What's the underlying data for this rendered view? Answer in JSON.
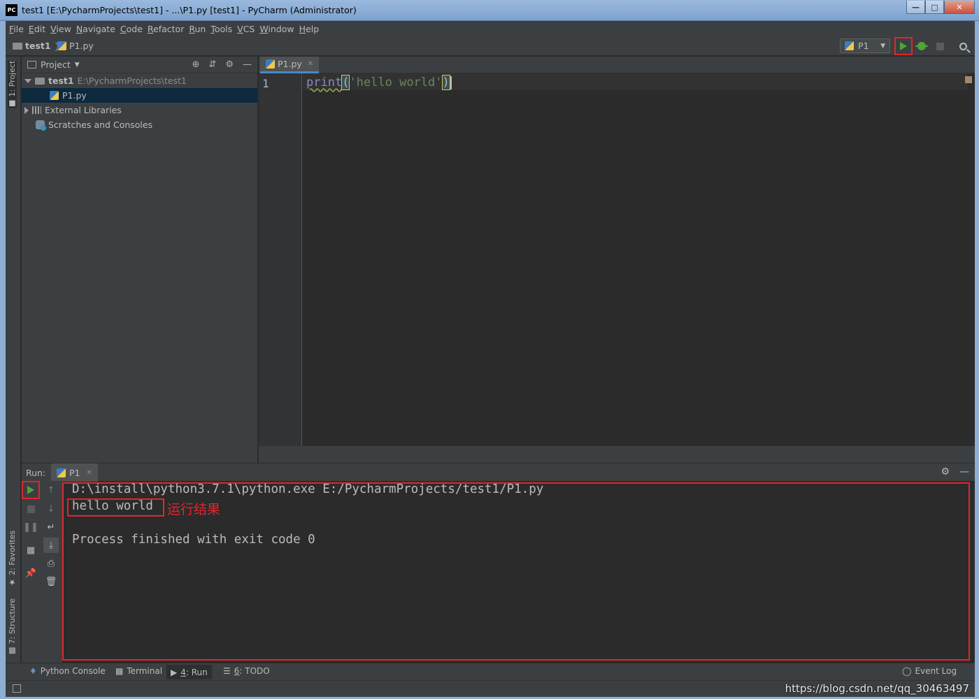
{
  "window": {
    "app_icon": "PC",
    "title": "test1 [E:\\PycharmProjects\\test1] - ...\\P1.py [test1] - PyCharm (Administrator)",
    "buttons": [
      "minimize",
      "maximize",
      "close"
    ]
  },
  "menu": [
    {
      "mnemonic": "F",
      "rest": "ile"
    },
    {
      "mnemonic": "E",
      "rest": "dit"
    },
    {
      "mnemonic": "V",
      "rest": "iew"
    },
    {
      "mnemonic": "N",
      "rest": "avigate"
    },
    {
      "mnemonic": "C",
      "rest": "ode"
    },
    {
      "mnemonic": "R",
      "rest": "efactor"
    },
    {
      "mnemonic": "R",
      "rest": "un"
    },
    {
      "mnemonic": "T",
      "rest": "ools"
    },
    {
      "mnemonic": "V",
      "rest": "CS"
    },
    {
      "mnemonic": "W",
      "rest": "indow"
    },
    {
      "mnemonic": "H",
      "rest": "elp"
    }
  ],
  "breadcrumb": {
    "project": "test1",
    "file": "P1.py"
  },
  "run_config": {
    "name": "P1",
    "run_icon": "run-icon",
    "debug_icon": "debug-icon",
    "stop_icon": "stop-icon",
    "search_icon": "search-icon",
    "highlight_color": "#e0262d",
    "run_color": "#4fa43b"
  },
  "side_tabs": {
    "project": "1: Project",
    "favorites": "2: Favorites",
    "structure": "7: Structure"
  },
  "project_panel": {
    "title": "Project",
    "root": {
      "name": "test1",
      "path": "E:\\PycharmProjects\\test1"
    },
    "file": "P1.py",
    "external": "External Libraries",
    "scratches": "Scratches and Consoles"
  },
  "editor": {
    "tab": "P1.py",
    "line_number": "1",
    "code": {
      "func": "print",
      "open": "(",
      "string": "'hello world'",
      "close": ")"
    }
  },
  "run_window": {
    "label": "Run:",
    "tab": "P1",
    "console": {
      "command": "D:\\install\\python3.7.1\\python.exe E:/PycharmProjects/test1/P1.py",
      "output": "hello world",
      "exit": "Process finished with exit code 0"
    },
    "annotation": "运行结果"
  },
  "bottom_tools": [
    {
      "label": "Python Console",
      "active": false
    },
    {
      "label": "Terminal",
      "active": false
    },
    {
      "mnemonic": "4",
      "label": ": Run",
      "active": true
    },
    {
      "mnemonic": "6",
      "label": ": TODO",
      "active": false
    }
  ],
  "event_log": "Event Log",
  "watermark": "https://blog.csdn.net/qq_30463497"
}
